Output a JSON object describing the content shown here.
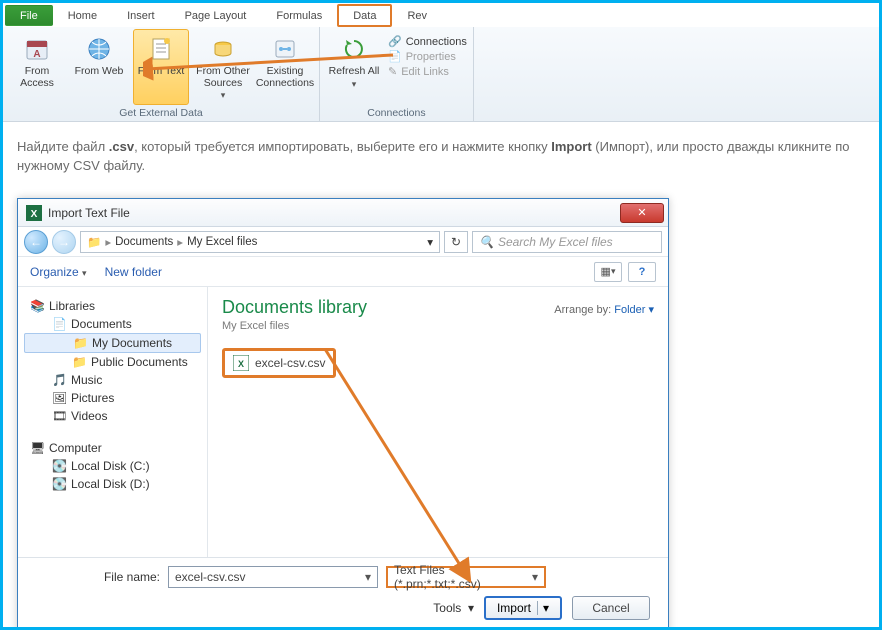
{
  "ribbon": {
    "tabs": [
      "File",
      "Home",
      "Insert",
      "Page Layout",
      "Formulas",
      "Data",
      "Rev"
    ],
    "active_tab": "Data",
    "get_external": {
      "from_access": "From Access",
      "from_web": "From Web",
      "from_text": "From Text",
      "from_other": "From Other Sources",
      "existing": "Existing Connections",
      "group_label": "Get External Data"
    },
    "connections": {
      "refresh": "Refresh All",
      "connections": "Connections",
      "properties": "Properties",
      "edit_links": "Edit Links",
      "group_label": "Connections"
    }
  },
  "instruction": {
    "prefix": "Найдите файл ",
    "ext": ".csv",
    "mid": ", который требуется импортировать, выберите его и нажмите кнопку ",
    "btn": "Import",
    "after_btn": " (Импорт), или просто дважды кликните по нужному CSV файлу."
  },
  "dialog": {
    "title": "Import Text File",
    "close": "✕",
    "nav": {
      "back": "←",
      "fwd": "→",
      "crumb1": "Documents",
      "crumb2": "My Excel files",
      "refresh": "↻"
    },
    "search_placeholder": "Search My Excel files",
    "toolbar": {
      "organize": "Organize",
      "new_folder": "New folder"
    },
    "tree": {
      "libraries": "Libraries",
      "documents": "Documents",
      "my_documents": "My Documents",
      "public_documents": "Public Documents",
      "music": "Music",
      "pictures": "Pictures",
      "videos": "Videos",
      "computer": "Computer",
      "disk_c": "Local Disk (C:)",
      "disk_d": "Local Disk (D:)"
    },
    "content": {
      "lib_title": "Documents library",
      "lib_sub": "My Excel files",
      "arrange_label": "Arrange by:",
      "arrange_value": "Folder",
      "file": "excel-csv.csv"
    },
    "bottom": {
      "file_name_label": "File name:",
      "file_name_value": "excel-csv.csv",
      "filter": "Text Files (*.prn;*.txt;*.csv)",
      "tools": "Tools",
      "import": "Import",
      "cancel": "Cancel"
    }
  }
}
